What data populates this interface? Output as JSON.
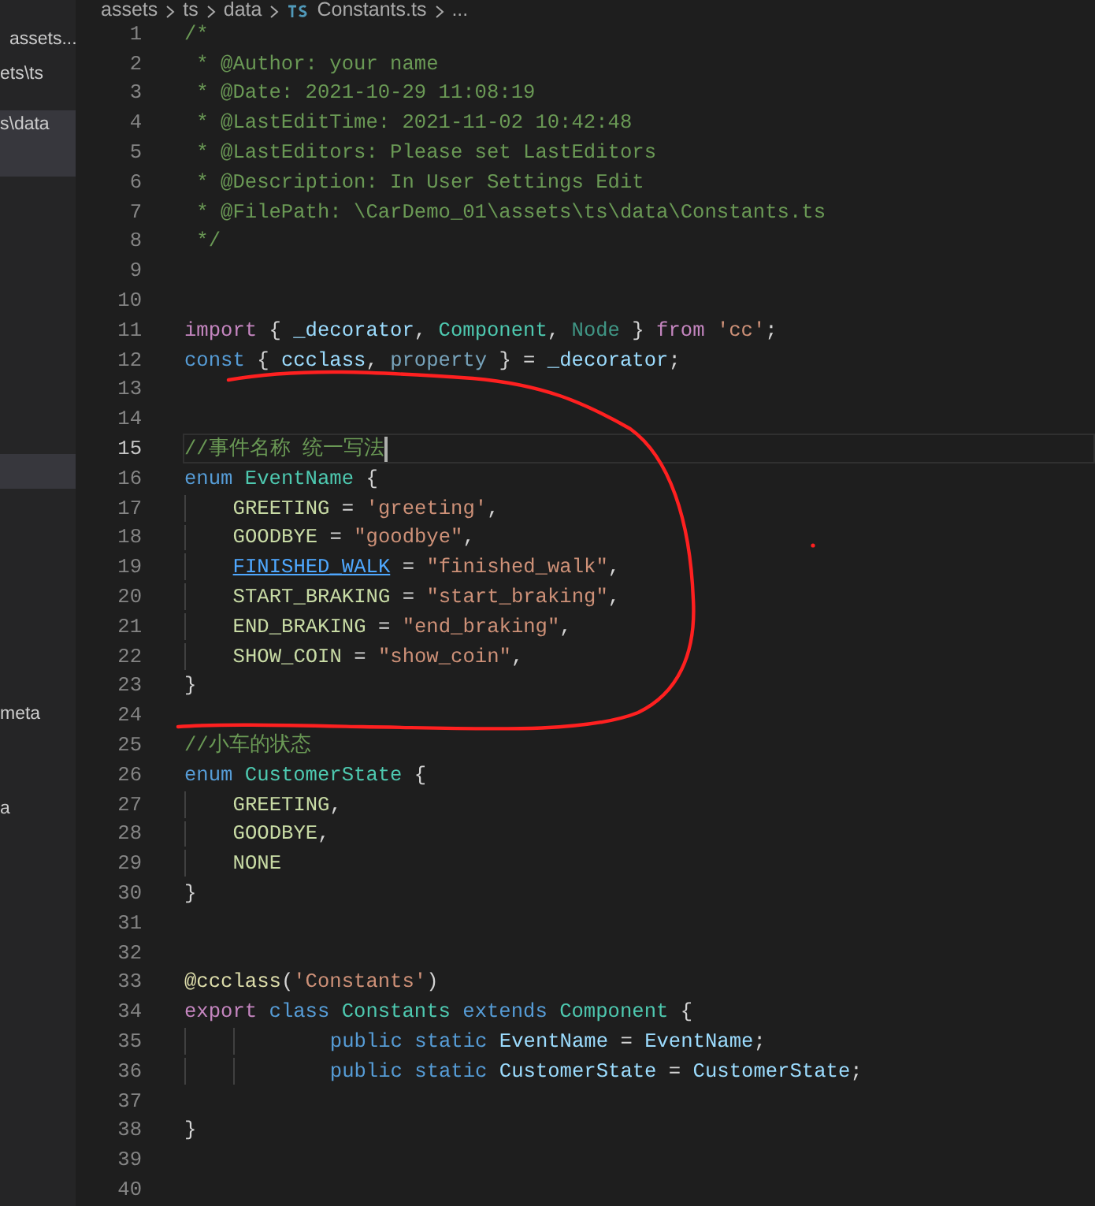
{
  "sidebar": {
    "items": [
      {
        "label": "assets...",
        "selected": false
      },
      {
        "label": "ets\\ts",
        "selected": false
      },
      {
        "label": "s\\data",
        "selected": true
      },
      {
        "selected": true
      },
      {
        "label": "meta",
        "selected": false
      },
      {
        "label": "a",
        "selected": false
      }
    ]
  },
  "breadcrumb": [
    {
      "kind": "folder",
      "label": "assets"
    },
    {
      "kind": "folder",
      "label": "ts"
    },
    {
      "kind": "folder",
      "label": "data"
    },
    {
      "kind": "file",
      "label": "Constants.ts"
    },
    {
      "kind": "more",
      "label": "..."
    }
  ],
  "editor": {
    "lines": [
      {
        "kind": "plain",
        "number": "1",
        "current": false,
        "tokens": [
          {
            "kind": "comment",
            "text": "/*"
          }
        ]
      },
      {
        "kind": "plain",
        "number": "2",
        "current": false,
        "tokens": [
          {
            "kind": "comment",
            "text": " * @Author: your name"
          }
        ]
      },
      {
        "kind": "plain",
        "number": "3",
        "current": false,
        "tokens": [
          {
            "kind": "comment",
            "text": " * @Date: 2021-10-29 11:08:19"
          }
        ]
      },
      {
        "kind": "plain",
        "number": "4",
        "current": false,
        "tokens": [
          {
            "kind": "comment",
            "text": " * @LastEditTime: 2021-11-02 10:42:48"
          }
        ]
      },
      {
        "kind": "plain",
        "number": "5",
        "current": false,
        "tokens": [
          {
            "kind": "comment",
            "text": " * @LastEditors: Please set LastEditors"
          }
        ]
      },
      {
        "kind": "plain",
        "number": "6",
        "current": false,
        "tokens": [
          {
            "kind": "comment",
            "text": " * @Description: In User Settings Edit"
          }
        ]
      },
      {
        "kind": "plain",
        "number": "7",
        "current": false,
        "tokens": [
          {
            "kind": "comment",
            "text": " * @FilePath: \\CarDemo_01\\assets\\ts\\data\\Constants.ts"
          }
        ]
      },
      {
        "kind": "plain",
        "number": "8",
        "current": false,
        "tokens": [
          {
            "kind": "comment",
            "text": " */"
          }
        ]
      },
      {
        "kind": "plain",
        "number": "9",
        "current": false
      },
      {
        "kind": "plain",
        "number": "10",
        "current": false
      },
      {
        "kind": "plain",
        "number": "11",
        "current": false,
        "tokens": [
          {
            "kind": "control",
            "text": "import"
          },
          {
            "kind": "punct",
            "text": " { "
          },
          {
            "kind": "variable",
            "text": "_decorator"
          },
          {
            "kind": "punct",
            "text": ", "
          },
          {
            "kind": "type",
            "text": "Component"
          },
          {
            "kind": "punct",
            "text": ", "
          },
          {
            "kind": "unused",
            "text": "Node"
          },
          {
            "kind": "punct",
            "text": " } "
          },
          {
            "kind": "control",
            "text": "from "
          },
          {
            "kind": "string",
            "text": "'cc'"
          },
          {
            "kind": "punct",
            "text": ";"
          }
        ]
      },
      {
        "kind": "plain",
        "number": "12",
        "current": false,
        "tokens": [
          {
            "kind": "keyword",
            "text": "const"
          },
          {
            "kind": "punct",
            "text": " { "
          },
          {
            "kind": "variable",
            "text": "ccclass"
          },
          {
            "kind": "punct",
            "text": ", "
          },
          {
            "kind": "unusedvar",
            "text": "property"
          },
          {
            "kind": "punct",
            "text": " } = "
          },
          {
            "kind": "variable",
            "text": "_decorator"
          },
          {
            "kind": "punct",
            "text": ";"
          }
        ]
      },
      {
        "kind": "plain",
        "number": "13",
        "current": false
      },
      {
        "kind": "plain",
        "number": "14",
        "current": false
      },
      {
        "kind": "plain",
        "number": "15",
        "current": true,
        "tokens": [
          {
            "kind": "comment",
            "text": "//事件名称 统一写法"
          }
        ]
      },
      {
        "kind": "plain",
        "number": "16",
        "current": false,
        "tokens": [
          {
            "kind": "keyword",
            "text": "enum "
          },
          {
            "kind": "type",
            "text": "EventName"
          },
          {
            "kind": "punct",
            "text": " {"
          }
        ]
      },
      {
        "kind": "member",
        "number": "17",
        "current": false,
        "tokens": [
          {
            "kind": "member",
            "text": "GREETING"
          },
          {
            "kind": "punct",
            "text": " = "
          },
          {
            "kind": "string",
            "text": "'greeting'"
          },
          {
            "kind": "punct",
            "text": ","
          }
        ]
      },
      {
        "kind": "member",
        "number": "18",
        "current": false,
        "tokens": [
          {
            "kind": "member",
            "text": "GOODBYE"
          },
          {
            "kind": "punct",
            "text": " = "
          },
          {
            "kind": "string",
            "text": "\"goodbye\""
          },
          {
            "kind": "punct",
            "text": ","
          }
        ]
      },
      {
        "kind": "member",
        "number": "19",
        "current": false,
        "tokens": [
          {
            "kind": "link",
            "text": "FINISHED_WALK"
          },
          {
            "kind": "punct",
            "text": " = "
          },
          {
            "kind": "string",
            "text": "\"finished_walk\""
          },
          {
            "kind": "punct",
            "text": ","
          }
        ]
      },
      {
        "kind": "member",
        "number": "20",
        "current": false,
        "tokens": [
          {
            "kind": "member",
            "text": "START_BRAKING"
          },
          {
            "kind": "punct",
            "text": " = "
          },
          {
            "kind": "string",
            "text": "\"start_braking\""
          },
          {
            "kind": "punct",
            "text": ","
          }
        ]
      },
      {
        "kind": "member",
        "number": "21",
        "current": false,
        "tokens": [
          {
            "kind": "member",
            "text": "END_BRAKING"
          },
          {
            "kind": "punct",
            "text": " = "
          },
          {
            "kind": "string",
            "text": "\"end_braking\""
          },
          {
            "kind": "punct",
            "text": ","
          }
        ]
      },
      {
        "kind": "member",
        "number": "22",
        "current": false,
        "tokens": [
          {
            "kind": "member",
            "text": "SHOW_COIN"
          },
          {
            "kind": "punct",
            "text": " = "
          },
          {
            "kind": "string",
            "text": "\"show_coin\""
          },
          {
            "kind": "punct",
            "text": ","
          }
        ]
      },
      {
        "kind": "plain",
        "number": "23",
        "current": false,
        "tokens": [
          {
            "kind": "punct",
            "text": "}"
          }
        ]
      },
      {
        "kind": "plain",
        "number": "24",
        "current": false
      },
      {
        "kind": "plain",
        "number": "25",
        "current": false,
        "tokens": [
          {
            "kind": "comment",
            "text": "//小车的状态"
          }
        ]
      },
      {
        "kind": "plain",
        "number": "26",
        "current": false,
        "tokens": [
          {
            "kind": "keyword",
            "text": "enum "
          },
          {
            "kind": "type",
            "text": "CustomerState"
          },
          {
            "kind": "punct",
            "text": " {"
          }
        ]
      },
      {
        "kind": "member",
        "number": "27",
        "current": false,
        "tokens": [
          {
            "kind": "member",
            "text": "GREETING"
          },
          {
            "kind": "punct",
            "text": ","
          }
        ]
      },
      {
        "kind": "member",
        "number": "28",
        "current": false,
        "tokens": [
          {
            "kind": "member",
            "text": "GOODBYE"
          },
          {
            "kind": "punct",
            "text": ","
          }
        ]
      },
      {
        "kind": "member",
        "number": "29",
        "current": false,
        "tokens": [
          {
            "kind": "member",
            "text": "NONE"
          }
        ]
      },
      {
        "kind": "plain",
        "number": "30",
        "current": false,
        "tokens": [
          {
            "kind": "punct",
            "text": "}"
          }
        ]
      },
      {
        "kind": "plain",
        "number": "31",
        "current": false
      },
      {
        "kind": "plain",
        "number": "32",
        "current": false
      },
      {
        "kind": "plain",
        "number": "33",
        "current": false,
        "tokens": [
          {
            "kind": "function",
            "text": "@ccclass"
          },
          {
            "kind": "punct",
            "text": "("
          },
          {
            "kind": "string",
            "text": "'Constants'"
          },
          {
            "kind": "punct",
            "text": ")"
          }
        ]
      },
      {
        "kind": "plain",
        "number": "34",
        "current": false,
        "tokens": [
          {
            "kind": "control",
            "text": "export "
          },
          {
            "kind": "keyword",
            "text": "class "
          },
          {
            "kind": "type",
            "text": "Constants "
          },
          {
            "kind": "keyword",
            "text": "extends "
          },
          {
            "kind": "type",
            "text": "Component"
          },
          {
            "kind": "punct",
            "text": " {"
          }
        ]
      },
      {
        "kind": "body",
        "number": "35",
        "current": false,
        "tokens": [
          {
            "kind": "keyword",
            "text": "public static "
          },
          {
            "kind": "variable",
            "text": "EventName"
          },
          {
            "kind": "punct",
            "text": " = "
          },
          {
            "kind": "variable",
            "text": "EventName"
          },
          {
            "kind": "punct",
            "text": ";"
          }
        ]
      },
      {
        "kind": "body",
        "number": "36",
        "current": false,
        "tokens": [
          {
            "kind": "keyword",
            "text": "public static "
          },
          {
            "kind": "variable",
            "text": "CustomerState"
          },
          {
            "kind": "punct",
            "text": " = "
          },
          {
            "kind": "variable",
            "text": "CustomerState"
          },
          {
            "kind": "punct",
            "text": ";"
          }
        ]
      },
      {
        "kind": "plain",
        "number": "37",
        "current": false
      },
      {
        "kind": "plain",
        "number": "38",
        "current": false,
        "tokens": [
          {
            "kind": "punct",
            "text": "}"
          }
        ]
      },
      {
        "kind": "plain",
        "number": "39",
        "current": false
      },
      {
        "kind": "plain",
        "number": "40",
        "current": false
      }
    ]
  }
}
